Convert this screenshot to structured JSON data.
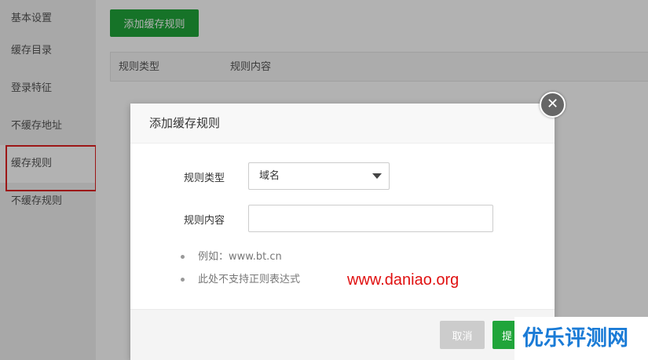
{
  "sidebar": {
    "items": [
      {
        "label": "基本设置"
      },
      {
        "label": "缓存目录"
      },
      {
        "label": "登录特征"
      },
      {
        "label": "不缓存地址"
      },
      {
        "label": "缓存规则"
      },
      {
        "label": "不缓存规则"
      }
    ],
    "active_index": 4
  },
  "main": {
    "add_button_label": "添加缓存规则",
    "table_headers": [
      "规则类型",
      "规则内容"
    ]
  },
  "modal": {
    "title": "添加缓存规则",
    "rule_type_label": "规则类型",
    "rule_type_value": "域名",
    "rule_content_label": "规则内容",
    "rule_content_value": "",
    "tips": [
      "例如：www.bt.cn",
      "此处不支持正则表达式"
    ],
    "cancel_label": "取消",
    "submit_label": "提"
  },
  "watermarks": {
    "site_url": "www.daniao.org",
    "site_brand": "优乐评测网"
  },
  "colors": {
    "primary_green": "#20a53a",
    "highlight_red": "#e02020",
    "watermark_red": "#e01010",
    "watermark_blue": "#1a7bd6"
  }
}
